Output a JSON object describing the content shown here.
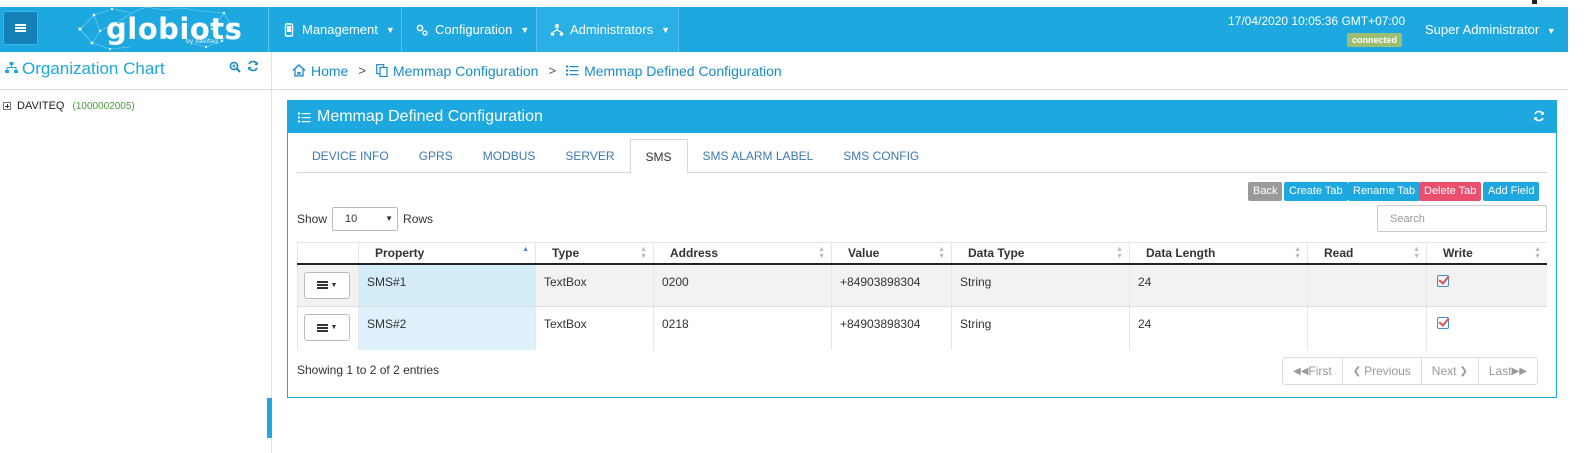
{
  "header": {
    "logo_text": "globiots",
    "logo_sub": "by daviteq",
    "nav": [
      {
        "label": "Management",
        "icon": "mobile-icon"
      },
      {
        "label": "Configuration",
        "icon": "gears-icon"
      },
      {
        "label": "Administrators",
        "icon": "sitemap-icon"
      }
    ],
    "datetime": "17/04/2020 10:05:36 GMT+07:00",
    "status": "connected",
    "user": "Super Administrator",
    "brand_color": "#1da8e0"
  },
  "sidebar": {
    "title": "Organization Chart",
    "tree": [
      {
        "label": "DAVITEQ",
        "code": "(1000002005)"
      }
    ]
  },
  "breadcrumb": {
    "home": "Home",
    "level1": "Memmap Configuration",
    "level2": "Memmap Defined Configuration"
  },
  "panel": {
    "title": "Memmap Defined Configuration",
    "tabs": [
      "DEVICE INFO",
      "GPRS",
      "MODBUS",
      "SERVER",
      "SMS",
      "SMS ALARM LABEL",
      "SMS CONFIG"
    ],
    "active_tab": "SMS",
    "buttons": {
      "back": "Back",
      "create_tab": "Create Tab",
      "rename_tab": "Rename Tab",
      "delete_tab": "Delete Tab",
      "add_field": "Add Field"
    },
    "show_label": "Show",
    "rows_label": "Rows",
    "page_size": "10",
    "search_placeholder": "Search",
    "columns": [
      "Property",
      "Type",
      "Address",
      "Value",
      "Data Type",
      "Data Length",
      "Read",
      "Write"
    ],
    "rows": [
      {
        "property": "SMS#1",
        "type": "TextBox",
        "address": "0200",
        "value": "+84903898304",
        "data_type": "String",
        "data_length": "24",
        "read": false,
        "write": true
      },
      {
        "property": "SMS#2",
        "type": "TextBox",
        "address": "0218",
        "value": "+84903898304",
        "data_type": "String",
        "data_length": "24",
        "read": false,
        "write": true
      }
    ],
    "info": "Showing 1 to 2 of 2 entries",
    "pager": {
      "first": "First",
      "previous": "Previous",
      "next": "Next",
      "last": "Last"
    }
  }
}
